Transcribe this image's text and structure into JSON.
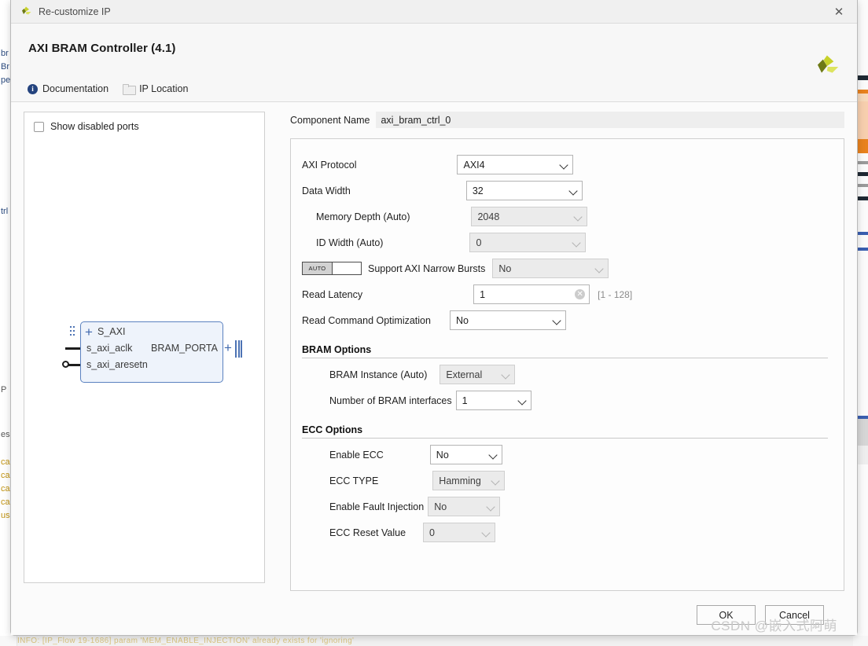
{
  "titlebar": {
    "title": "Re-customize IP",
    "close_icon": "close-icon",
    "app_icon": "xilinx-logo-icon"
  },
  "header": {
    "ip_title": "AXI BRAM Controller (4.1)",
    "logo_icon": "xilinx-pinwheel-logo",
    "links": [
      {
        "label": "Documentation",
        "icon": "info-icon"
      },
      {
        "label": "IP Location",
        "icon": "folder-icon"
      }
    ]
  },
  "left_panel": {
    "show_disabled_ports": {
      "label": "Show disabled ports",
      "checked": false
    },
    "ip_symbol": {
      "interface_in": "S_AXI",
      "pin_clk": "s_axi_aclk",
      "pin_resetn": "s_axi_aresetn",
      "interface_out": "BRAM_PORTA"
    }
  },
  "component": {
    "label": "Component Name",
    "value": "axi_bram_ctrl_0"
  },
  "params": [
    {
      "label": "AXI Protocol",
      "value": "AXI4",
      "type": "combo",
      "enabled": true,
      "indent": false
    },
    {
      "label": "Data Width",
      "value": "32",
      "type": "combo",
      "enabled": true,
      "indent": false
    },
    {
      "label": "Memory Depth (Auto)",
      "value": "2048",
      "type": "combo",
      "enabled": false,
      "indent": true
    },
    {
      "label": "ID Width (Auto)",
      "value": "0",
      "type": "combo",
      "enabled": false,
      "indent": true
    },
    {
      "label": "Support AXI Narrow Bursts",
      "value": "No",
      "type": "combo",
      "enabled": false,
      "indent": false,
      "auto_toggle": "AUTO"
    },
    {
      "label": "Read Latency",
      "value": "1",
      "type": "text",
      "enabled": true,
      "indent": false,
      "hint": "[1 - 128]"
    },
    {
      "label": "Read Command Optimization",
      "value": "No",
      "type": "combo",
      "enabled": true,
      "indent": false
    }
  ],
  "bram_options": {
    "title": "BRAM Options",
    "rows": [
      {
        "label": "BRAM Instance (Auto)",
        "value": "External",
        "enabled": false
      },
      {
        "label": "Number of BRAM interfaces",
        "value": "1",
        "enabled": true
      }
    ]
  },
  "ecc_options": {
    "title": "ECC Options",
    "rows": [
      {
        "label": "Enable ECC",
        "value": "No",
        "enabled": true
      },
      {
        "label": "ECC TYPE",
        "value": "Hamming",
        "enabled": false
      },
      {
        "label": "Enable Fault Injection",
        "value": "No",
        "enabled": false
      },
      {
        "label": "ECC Reset Value",
        "value": "0",
        "enabled": false
      }
    ]
  },
  "footer": {
    "ok_label": "OK",
    "cancel_label": "Cancel",
    "watermark": "CSDN @嵌入式阿萌"
  },
  "background": {
    "left_fragments": [
      "br",
      "Br",
      "pe",
      "trl",
      "P",
      "es",
      "ca",
      "ca",
      "ca",
      "ca",
      "us"
    ],
    "bottom_text": "INFO: [IP_Flow 19-1686] param 'MEM_ENABLE_INJECTION' already exists for 'ignoring'"
  },
  "colors": {
    "accent_blue": "#24437e",
    "ip_block_border": "#5b82c0",
    "ip_block_fill": "#eef3fb",
    "logo_yellow": "#c7d12a",
    "logo_olive": "#6e7a16"
  }
}
